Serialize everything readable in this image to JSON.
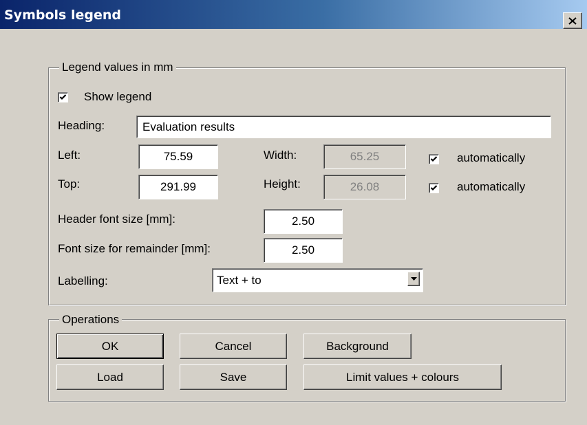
{
  "window": {
    "title": "Symbols legend",
    "close_symbol": "✕"
  },
  "legend_group": {
    "title": "Legend values in mm",
    "show_legend": {
      "label": "Show legend",
      "checked": true
    },
    "heading": {
      "label": "Heading:",
      "value": "Evaluation results"
    },
    "left": {
      "label": "Left:",
      "value": "75.59"
    },
    "top": {
      "label": "Top:",
      "value": "291.99"
    },
    "width": {
      "label": "Width:",
      "value": "65.25",
      "auto_label": "automatically",
      "auto_checked": true
    },
    "height": {
      "label": "Height:",
      "value": "26.08",
      "auto_label": "automatically",
      "auto_checked": true
    },
    "header_font_size": {
      "label": "Header font size [mm]:",
      "value": "2.50"
    },
    "remainder_font_size": {
      "label": "Font size for remainder [mm]:",
      "value": "2.50"
    },
    "labelling": {
      "label": "Labelling:",
      "selected": "Text + to"
    }
  },
  "operations_group": {
    "title": "Operations",
    "buttons": {
      "ok": "OK",
      "cancel": "Cancel",
      "background": "Background",
      "load": "Load",
      "save": "Save",
      "limit_values": "Limit values + colours"
    }
  },
  "icons": {
    "checkbox": "check-icon",
    "combo_arrow": "chevron-down-icon",
    "close": "close-icon"
  },
  "colors": {
    "face": "#d4d0c8",
    "title_start": "#0a246a",
    "title_end": "#a6caf0"
  }
}
